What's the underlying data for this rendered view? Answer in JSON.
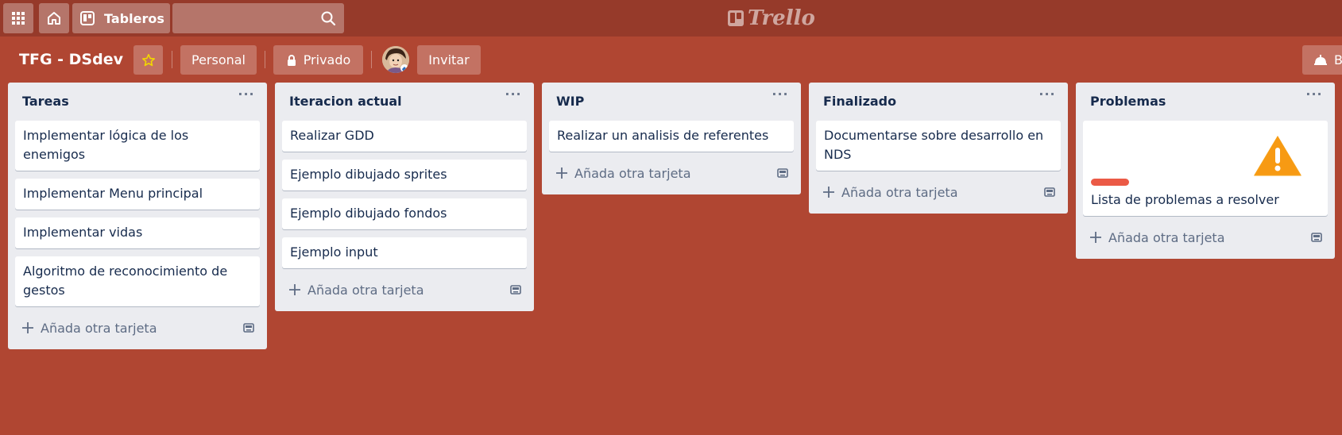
{
  "topbar": {
    "boards_label": "Tableros",
    "search": {
      "value": ""
    },
    "logo_text": "Trello"
  },
  "board": {
    "title": "TFG - DSdev",
    "personal_label": "Personal",
    "private_label": "Privado",
    "invite_label": "Invitar",
    "menu_label": "B"
  },
  "lists": [
    {
      "title": "Tareas",
      "menu": "···",
      "cards": [
        "Implementar lógica de los enemigos",
        "Implementar Menu principal",
        "Implementar vidas",
        "Algoritmo de reconocimiento de gestos"
      ],
      "add_label": "Añada otra tarjeta"
    },
    {
      "title": "Iteracion actual",
      "menu": "···",
      "cards": [
        "Realizar GDD",
        "Ejemplo dibujado sprites",
        "Ejemplo dibujado fondos",
        "Ejemplo input"
      ],
      "add_label": "Añada otra tarjeta"
    },
    {
      "title": "WIP",
      "menu": "···",
      "cards": [
        "Realizar un analisis de referentes"
      ],
      "add_label": "Añada otra tarjeta"
    },
    {
      "title": "Finalizado",
      "menu": "···",
      "cards": [
        "Documentarse sobre desarrollo en NDS"
      ],
      "add_label": "Añada otra tarjeta"
    },
    {
      "title": "Problemas",
      "menu": "···",
      "cards": [
        "Lista de problemas a resolver"
      ],
      "add_label": "Añada otra tarjeta"
    }
  ],
  "colors": {
    "background": "#b04632",
    "topbar": "#963a2a",
    "list_bg": "#ebecf0",
    "label_red": "#eb5a46",
    "star": "#f2d600"
  }
}
